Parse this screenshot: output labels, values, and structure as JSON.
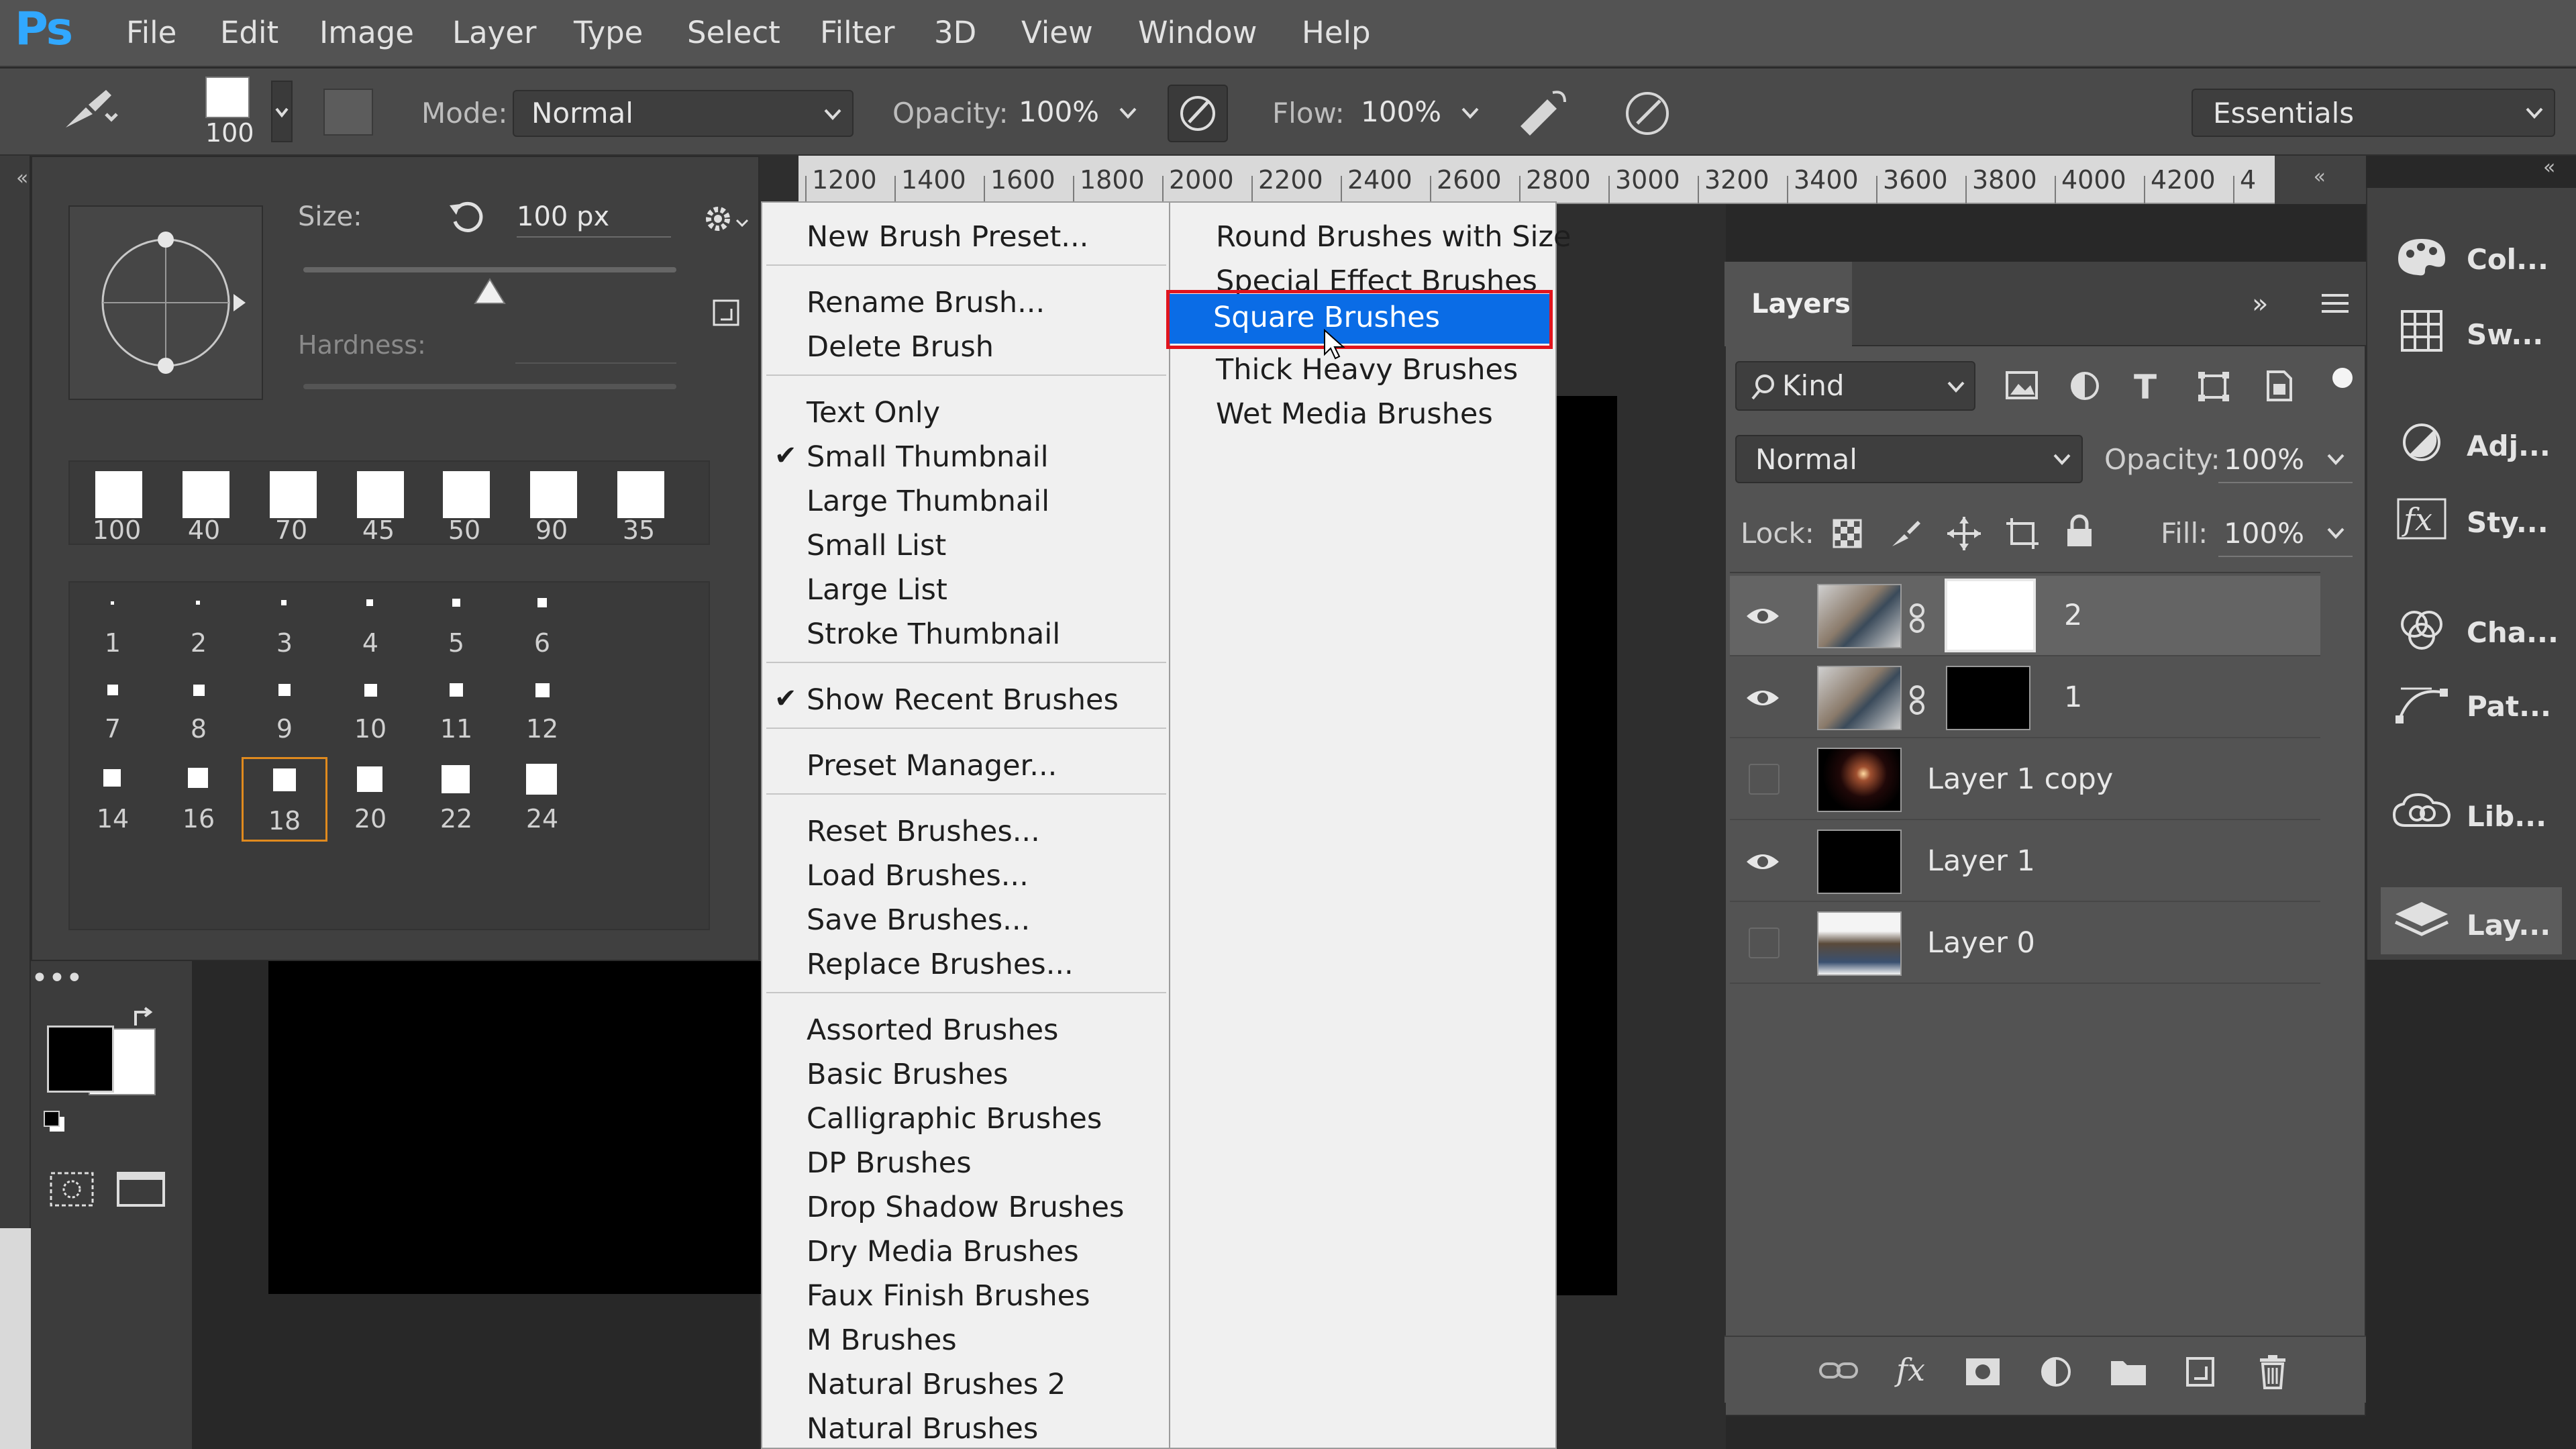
{
  "app": {
    "logo": "Ps"
  },
  "menubar": {
    "items": [
      "File",
      "Edit",
      "Image",
      "Layer",
      "Type",
      "Select",
      "Filter",
      "3D",
      "View",
      "Window",
      "Help"
    ]
  },
  "options": {
    "brush_size": "100",
    "mode_label": "Mode:",
    "mode_value": "Normal",
    "opacity_label": "Opacity:",
    "opacity_value": "100%",
    "flow_label": "Flow:",
    "flow_value": "100%",
    "workspace": "Essentials"
  },
  "picker": {
    "size_label": "Size:",
    "size_value": "100 px",
    "hardness_label": "Hardness:",
    "size_slider_fraction": 0.5,
    "large_thumbs": [
      "100",
      "40",
      "70",
      "45",
      "50",
      "90",
      "35"
    ],
    "small_row1": [
      "1",
      "2",
      "3",
      "4",
      "5",
      "6"
    ],
    "small_row2": [
      "7",
      "8",
      "9",
      "10",
      "11",
      "12"
    ],
    "small_row3": [
      "14",
      "16",
      "18",
      "20",
      "22",
      "24"
    ],
    "selected": "18"
  },
  "ruler": {
    "ticks": [
      "1200",
      "1400",
      "1600",
      "1800",
      "2000",
      "2200",
      "2400",
      "2600",
      "2800",
      "3000",
      "3200",
      "3400",
      "3600",
      "3800",
      "4000",
      "4200",
      "4"
    ]
  },
  "context_menu": {
    "new_preset": "New Brush Preset...",
    "rename": "Rename Brush...",
    "delete": "Delete Brush",
    "text_only": "Text Only",
    "small_thumb": "Small Thumbnail",
    "large_thumb": "Large Thumbnail",
    "small_list": "Small List",
    "large_list": "Large List",
    "stroke_thumb": "Stroke Thumbnail",
    "show_recent": "Show Recent Brushes",
    "preset_manager": "Preset Manager...",
    "reset": "Reset Brushes...",
    "load": "Load Brushes...",
    "save": "Save Brushes...",
    "replace": "Replace Brushes...",
    "libs": [
      "Assorted Brushes",
      "Basic Brushes",
      "Calligraphic Brushes",
      "DP Brushes",
      "Drop Shadow Brushes",
      "Dry Media Brushes",
      "Faux Finish Brushes",
      "M Brushes",
      "Natural Brushes 2",
      "Natural Brushes"
    ]
  },
  "submenu": {
    "items": [
      "Round Brushes with Size",
      "Special Effect Brushes",
      "Square Brushes",
      "Thick Heavy Brushes",
      "Wet Media Brushes"
    ],
    "highlighted": "Square Brushes"
  },
  "layers": {
    "tab": "Layers",
    "filter_kind": "Kind",
    "blend": "Normal",
    "opacity_label": "Opacity:",
    "opacity_value": "100%",
    "lock_label": "Lock:",
    "fill_label": "Fill:",
    "fill_value": "100%",
    "rows": [
      {
        "name": "2",
        "visible": true
      },
      {
        "name": "1",
        "visible": true
      },
      {
        "name": "Layer 1 copy",
        "visible": false
      },
      {
        "name": "Layer 1",
        "visible": true
      },
      {
        "name": "Layer 0",
        "visible": false
      }
    ]
  },
  "right_panels": [
    "Col...",
    "Sw...",
    "Adj...",
    "Sty...",
    "Cha...",
    "Pat...",
    "Lib...",
    "Lay..."
  ]
}
